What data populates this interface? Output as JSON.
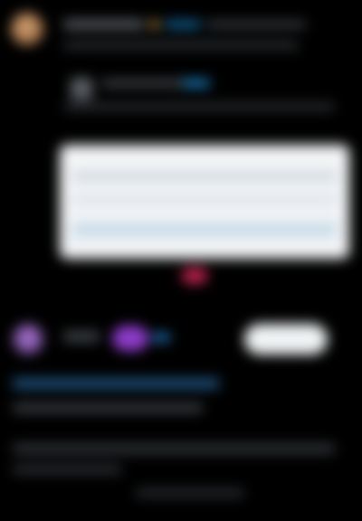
{
  "colors": {
    "background": "#000000",
    "accent_blue": "#1d8fd8",
    "verified_gold": "#d6a048",
    "media_card": "#f2f4f6",
    "badge_purple": "#8d3cc9",
    "like_red": "#c0234f",
    "button_light": "#eff3f4"
  },
  "icons": {
    "top_avatar": "avatar",
    "verified_badge": "verified-badge-icon",
    "quoted_avatar": "avatar",
    "second_avatar": "avatar",
    "like": "heart-icon"
  },
  "second_post": {
    "follow_label": ""
  }
}
